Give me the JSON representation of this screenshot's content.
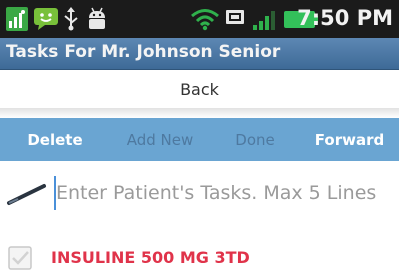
{
  "status_bar": {
    "time": "7:50 PM",
    "icons": [
      "signal-bars-notification-icon",
      "chat-notification-icon",
      "usb-icon",
      "android-debug-icon",
      "wifi-icon",
      "sim-card-icon",
      "cell-signal-icon",
      "battery-icon"
    ]
  },
  "title_bar": {
    "title": "Tasks For Mr. Johnson Senior"
  },
  "back_bar": {
    "back_label": "Back"
  },
  "action_bar": {
    "delete_label": "Delete",
    "add_new_label": "Add New",
    "done_label": "Done",
    "forward_label": "Forward"
  },
  "task_input": {
    "placeholder": "Enter Patient's Tasks. Max 5 Lines",
    "value": ""
  },
  "tasks": [
    {
      "label": "INSULINE 500 MG 3TD",
      "checked": false
    }
  ],
  "colors": {
    "title_bar": "#4c78a6",
    "action_bar": "#6aa5d2",
    "task_text": "#e0334a",
    "status_bar": "#1b1b1b",
    "battery": "#33c05a"
  }
}
